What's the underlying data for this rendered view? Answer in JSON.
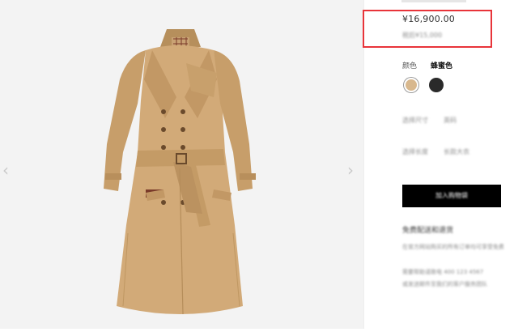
{
  "product": {
    "price": "¥16,900.00",
    "original_price": "税后¥15,000",
    "color_label": "颜色",
    "color_value": "蜂蜜色",
    "swatches": [
      {
        "name": "蜂蜜色",
        "color": "#d8b88e",
        "selected": true
      },
      {
        "name": "黑色",
        "color": "#2a2a2a",
        "selected": false
      }
    ],
    "size_label": "选择尺寸",
    "size_value": "英码",
    "length_label": "选择长度",
    "length_value": "长款大衣",
    "add_to_cart": "加入购物袋",
    "shipping_title": "免费配送和退货",
    "paragraphs": [
      "在官方网站购买的所有订单均可享受免费配送服务",
      "需要帮助请致电 400 123 4567",
      "或发送邮件至我们的客户服务团队"
    ]
  },
  "colors": {
    "highlight_border": "#e8343a",
    "button_bg": "#000000",
    "gallery_bg": "#f3f3f3"
  },
  "icons": {
    "prev": "chevron-left-icon",
    "next": "chevron-right-icon"
  }
}
